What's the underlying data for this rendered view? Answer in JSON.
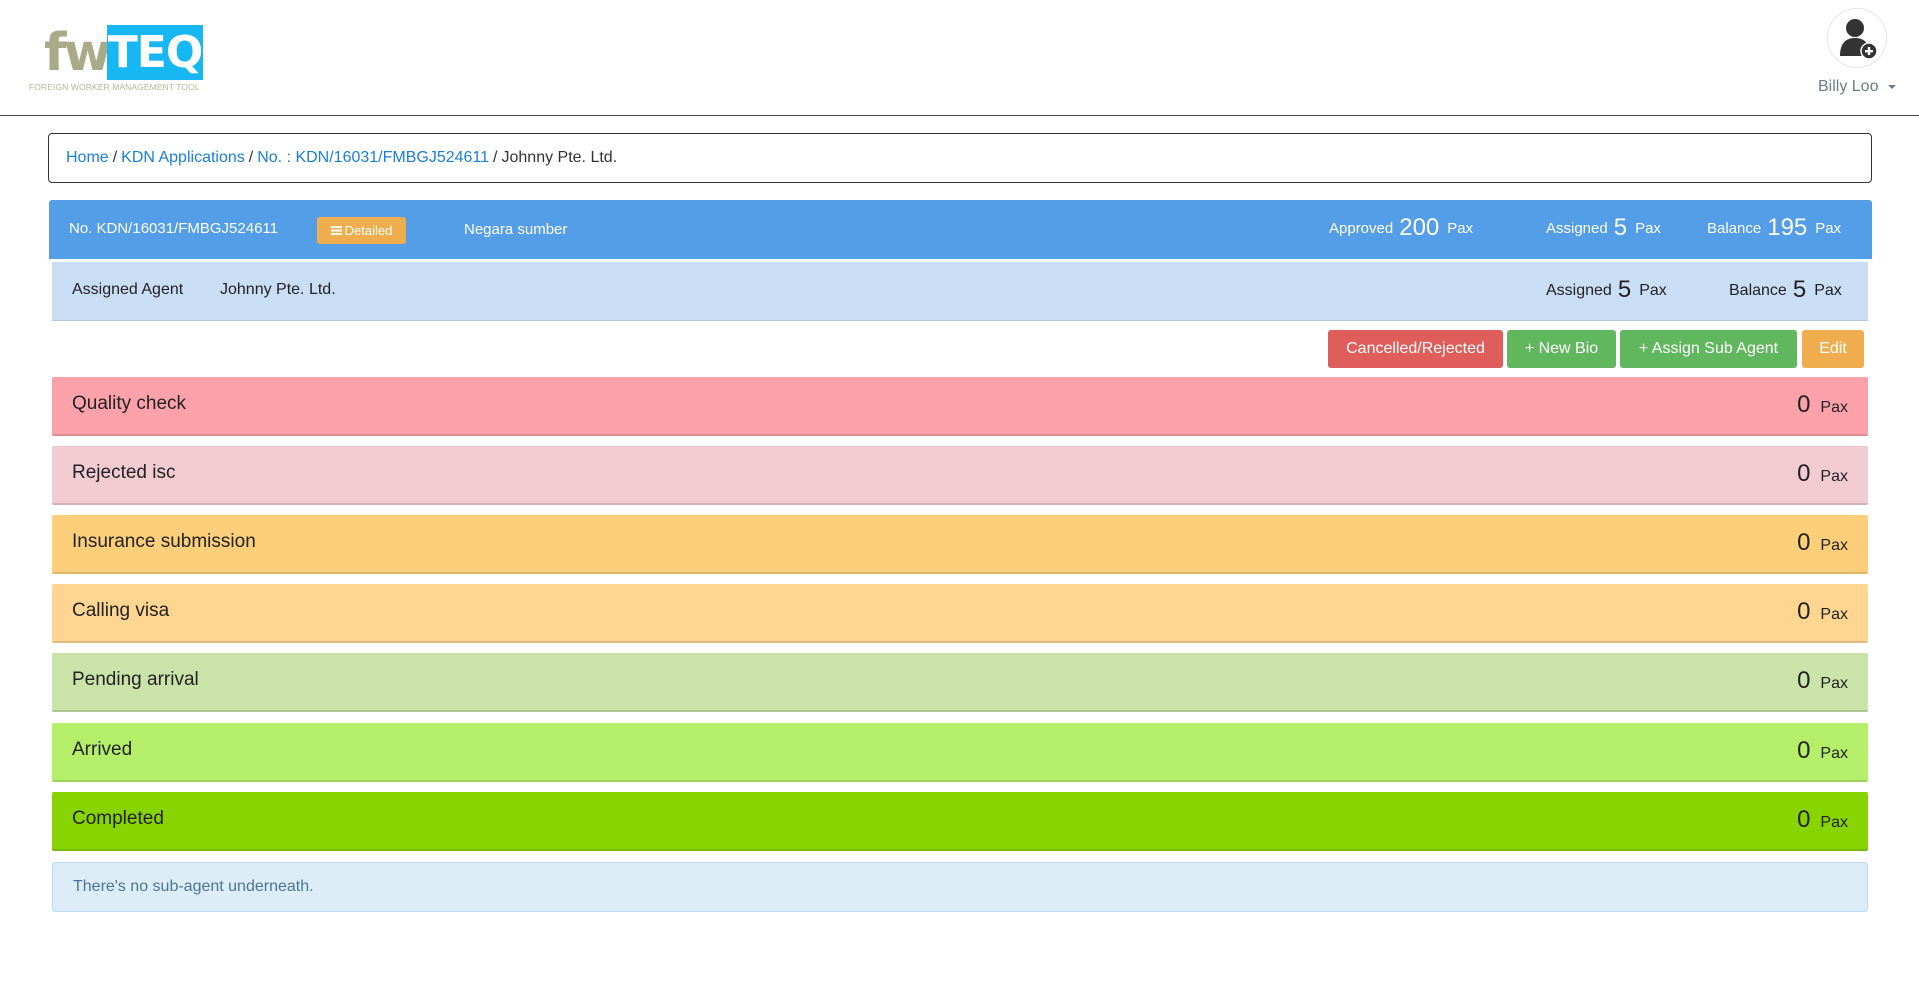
{
  "header": {
    "logo": {
      "part1": "fw",
      "part2": "TEQ",
      "tagline": "FOREIGN WORKER MANAGEMENT TOOL"
    },
    "user": {
      "name": "Billy Loo",
      "avatar_icon": "user-plus-icon"
    }
  },
  "breadcrumb": {
    "items": [
      {
        "label": "Home",
        "link": true
      },
      {
        "label": "KDN Applications",
        "link": true
      },
      {
        "label": "No. : KDN/16031/FMBGJ524611",
        "link": true
      },
      {
        "label": "Johnny Pte. Ltd.",
        "link": false
      }
    ],
    "separator": "/"
  },
  "summary": {
    "reference": "No. KDN/16031/FMBGJ524611",
    "detailed_label": "Detailed",
    "detailed_icon": "list-icon",
    "source_country_label": "Negara sumber",
    "approved": {
      "label": "Approved",
      "value": "200",
      "unit": "Pax"
    },
    "assigned": {
      "label": "Assigned",
      "value": "5",
      "unit": "Pax"
    },
    "balance": {
      "label": "Balance",
      "value": "195",
      "unit": "Pax"
    },
    "color": "#539ee6"
  },
  "agent": {
    "label": "Assigned Agent",
    "name": "Johnny Pte. Ltd.",
    "assigned": {
      "label": "Assigned",
      "value": "5",
      "unit": "Pax"
    },
    "balance": {
      "label": "Balance",
      "value": "5",
      "unit": "Pax"
    }
  },
  "actions": {
    "cancelled_rejected": "Cancelled/Rejected",
    "new_bio": "+ New Bio",
    "assign_sub_agent": "+ Assign Sub Agent",
    "edit": "Edit"
  },
  "statuses": [
    {
      "name": "Quality check",
      "count": "0",
      "unit": "Pax",
      "color": "#fda2ab"
    },
    {
      "name": "Rejected isc",
      "count": "0",
      "unit": "Pax",
      "color": "#f2cbd1"
    },
    {
      "name": "Insurance submission",
      "count": "0",
      "unit": "Pax",
      "color": "#fdcf7a"
    },
    {
      "name": "Calling visa",
      "count": "0",
      "unit": "Pax",
      "color": "#ffd592"
    },
    {
      "name": "Pending arrival",
      "count": "0",
      "unit": "Pax",
      "color": "#cae3a9"
    },
    {
      "name": "Arrived",
      "count": "0",
      "unit": "Pax",
      "color": "#b5ee69"
    },
    {
      "name": "Completed",
      "count": "0",
      "unit": "Pax",
      "color": "#88d400"
    }
  ],
  "sub_agent_message": "There's no sub-agent underneath."
}
